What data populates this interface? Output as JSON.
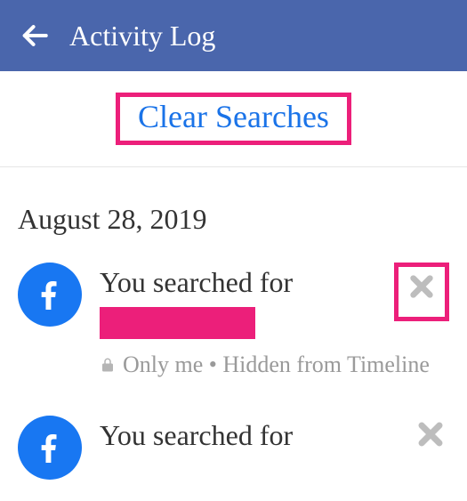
{
  "header": {
    "title": "Activity Log"
  },
  "clearSearches": {
    "label": "Clear Searches"
  },
  "date": "August 28, 2019",
  "items": [
    {
      "text": "You searched for",
      "privacy": "Only me • Hidden from Timeline"
    },
    {
      "text": "You searched for"
    }
  ]
}
